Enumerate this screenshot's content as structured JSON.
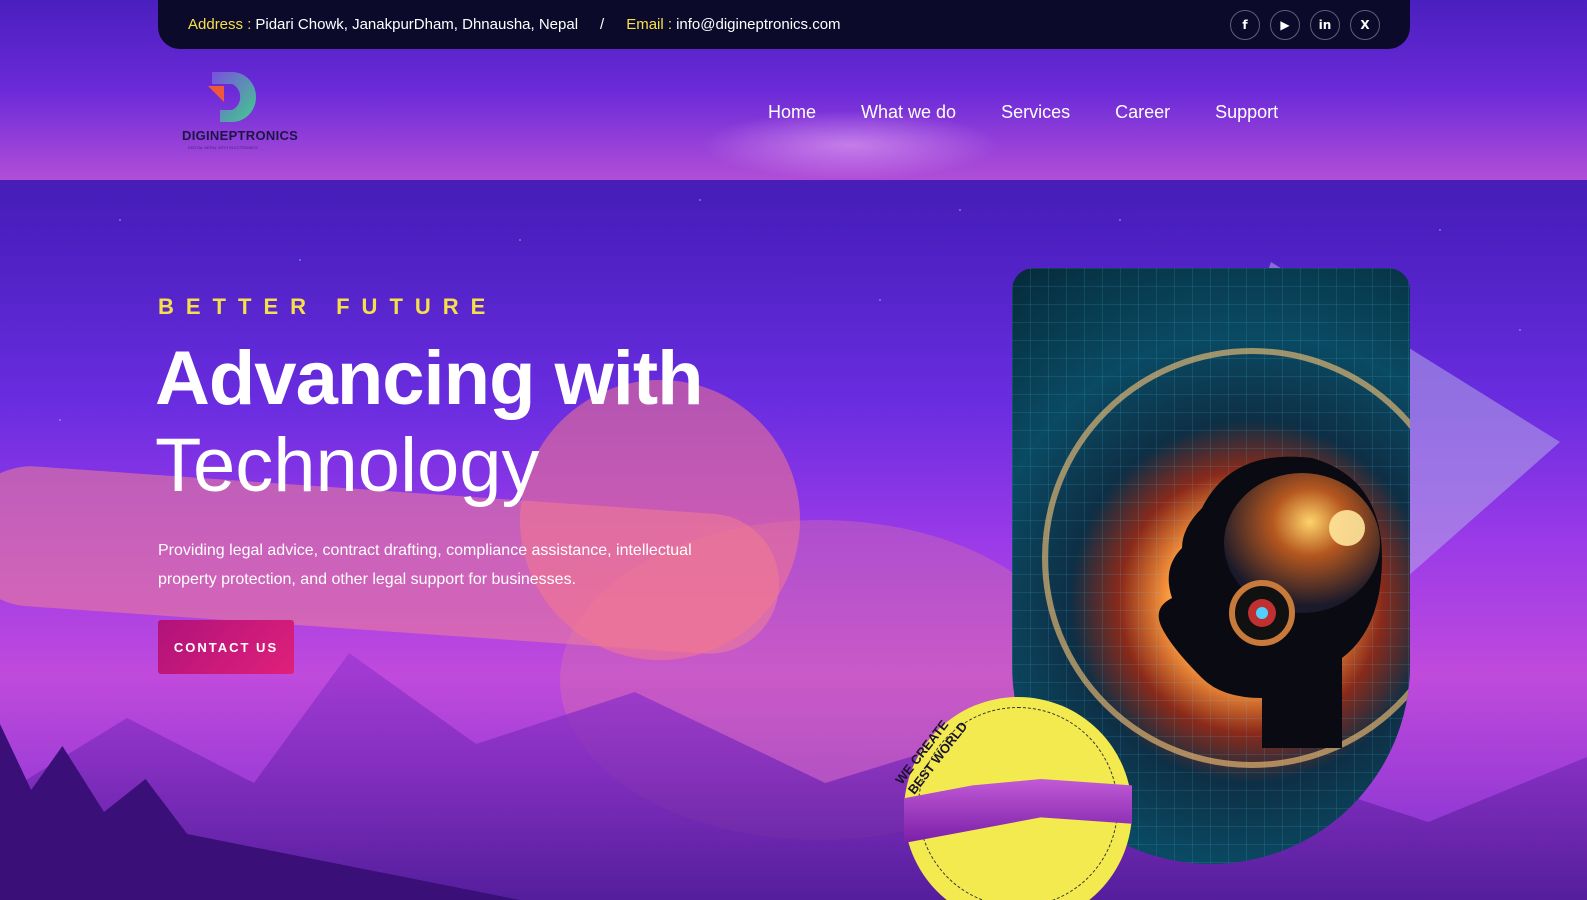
{
  "topbar": {
    "address_label": "Address :",
    "address_value": "Pidari Chowk, JanakpurDham, Dhnausha, Nepal",
    "separator": "/",
    "email_label": "Email :",
    "email_value": "info@digineptronics.com",
    "socials": [
      {
        "icon": "facebook-icon",
        "glyph": "f"
      },
      {
        "icon": "youtube-icon",
        "glyph": "▶"
      },
      {
        "icon": "linkedin-icon",
        "glyph": "in"
      },
      {
        "icon": "x-icon",
        "glyph": "X"
      }
    ]
  },
  "brand": {
    "name": "DIGINEPTRONICS",
    "tagline": "DIGITAL NEPAL WITH ELECTRONICS"
  },
  "nav": {
    "items": [
      "Home",
      "What we do",
      "Services",
      "Career",
      "Support"
    ]
  },
  "hero": {
    "eyebrow": "BETTER FUTURE",
    "title_line1": "Advancing with",
    "title_line2": "Technology",
    "description": "Providing legal advice, contract drafting, compliance assistance, intellectual property protection, and other legal support for businesses.",
    "cta_label": "CONTACT US"
  },
  "badge": {
    "line1": "WE CREATE",
    "line2": "BEST WORLD"
  },
  "colors": {
    "accent_yellow": "#f6e04a",
    "cta_pink": "#d01878",
    "topbar_bg": "#0b0a2a"
  }
}
